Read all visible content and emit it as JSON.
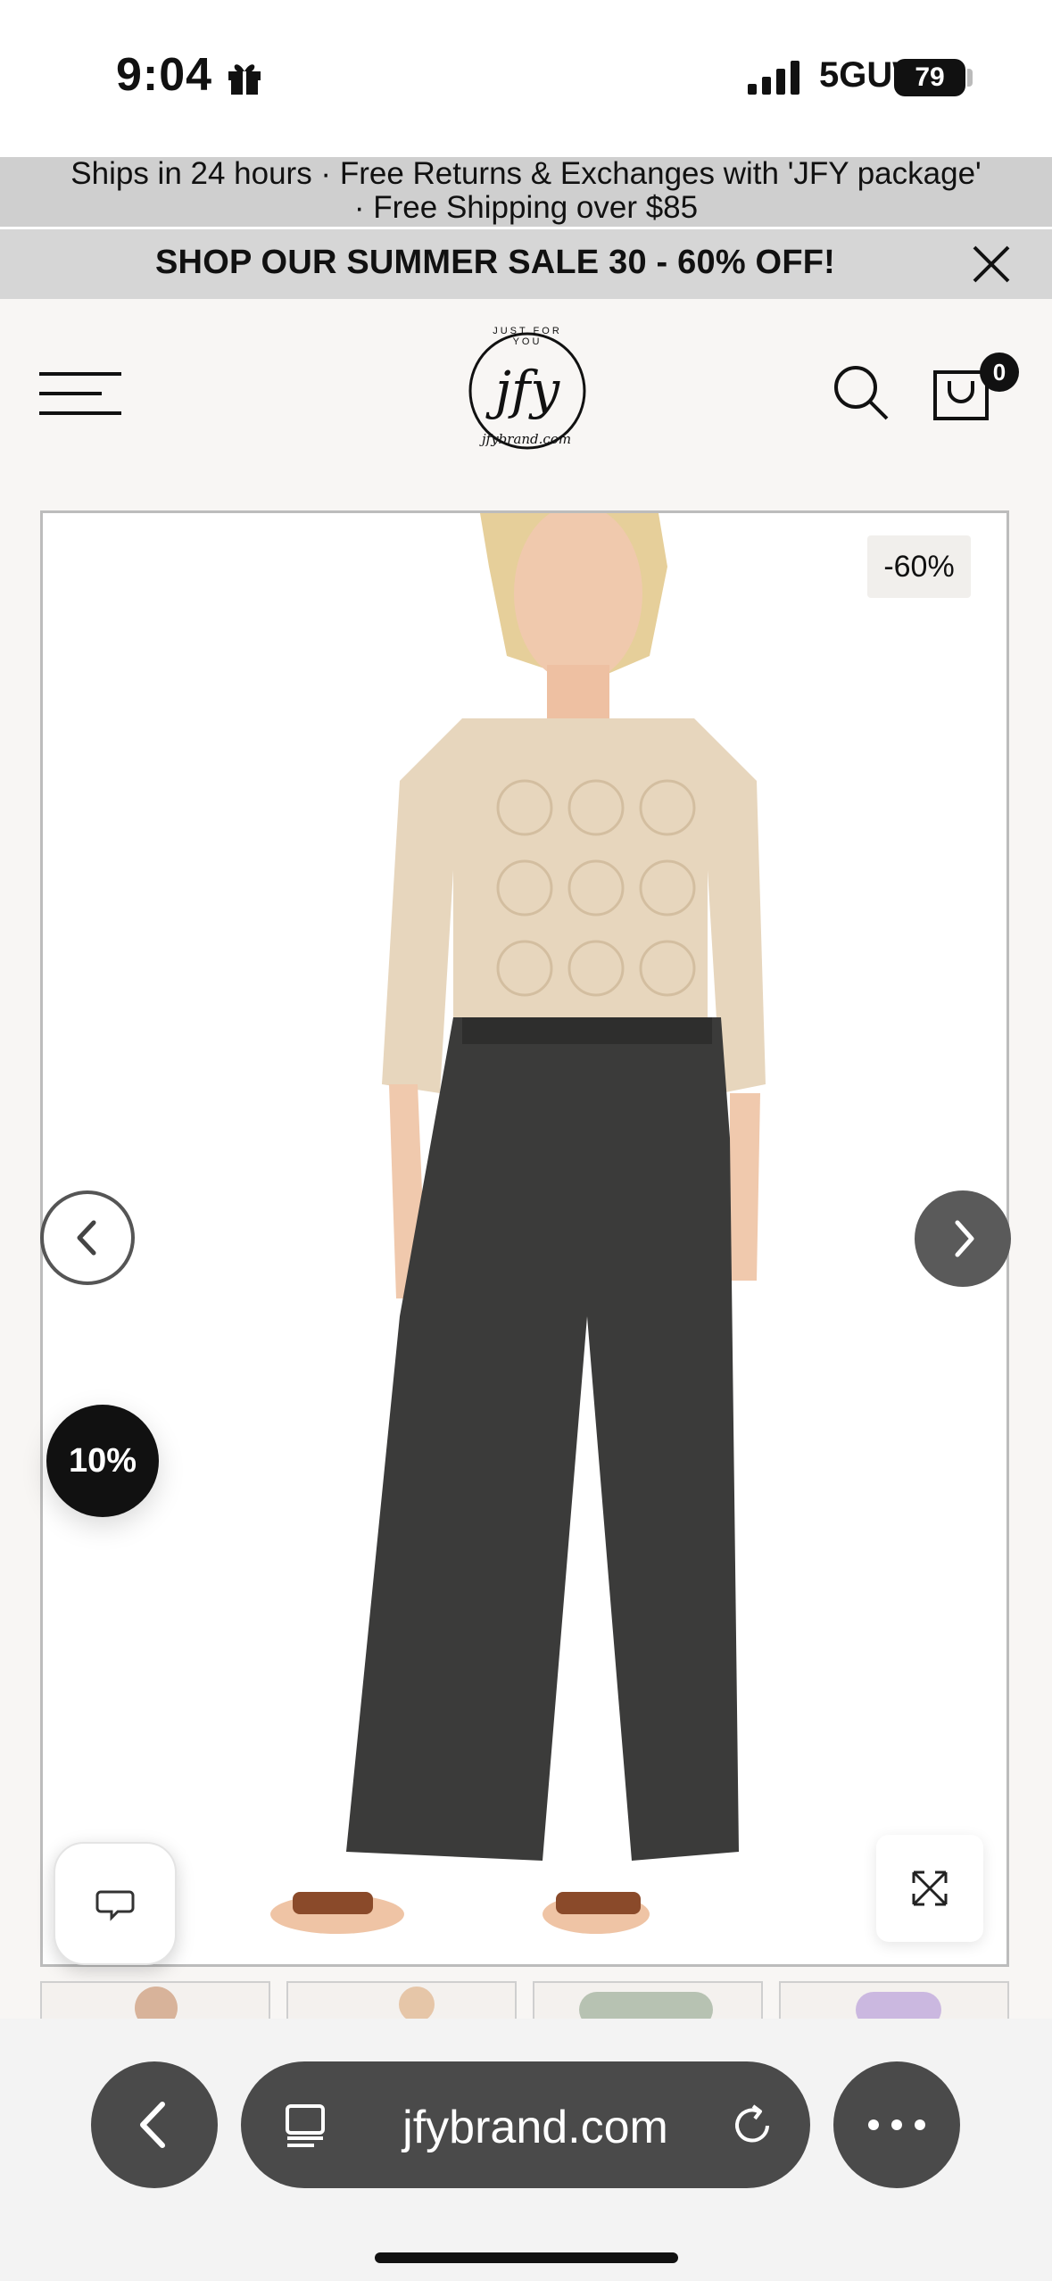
{
  "status_bar": {
    "time": "9:04",
    "network": "5GUW",
    "battery": "79"
  },
  "announcement": {
    "line1": "Ships in 24 hours · Free Returns & Exchanges with 'JFY package'",
    "line2": "· Free Shipping over $85"
  },
  "promo_bar": {
    "text": "SHOP OUR SUMMER SALE 30 - 60% OFF!"
  },
  "header": {
    "logo_top": "JUST FOR YOU",
    "logo_main": "jfy",
    "logo_bottom": "jfybrand.com",
    "cart_count": "0"
  },
  "product": {
    "discount_badge": "-60%",
    "popup_badge": "10%"
  },
  "browser": {
    "url": "jfybrand.com"
  },
  "colors": {
    "announcement_bg": "#cfcfcf",
    "promo_bg": "#d6d6d6",
    "page_bg": "#f8f6f4",
    "browser_button": "#4a4a4a"
  },
  "icons": [
    "gift-icon",
    "signal-icon",
    "close-icon",
    "menu-icon",
    "search-icon",
    "cart-icon",
    "chevron-left-icon",
    "chevron-right-icon",
    "chat-icon",
    "expand-icon",
    "reader-icon",
    "reload-icon",
    "more-icon"
  ]
}
